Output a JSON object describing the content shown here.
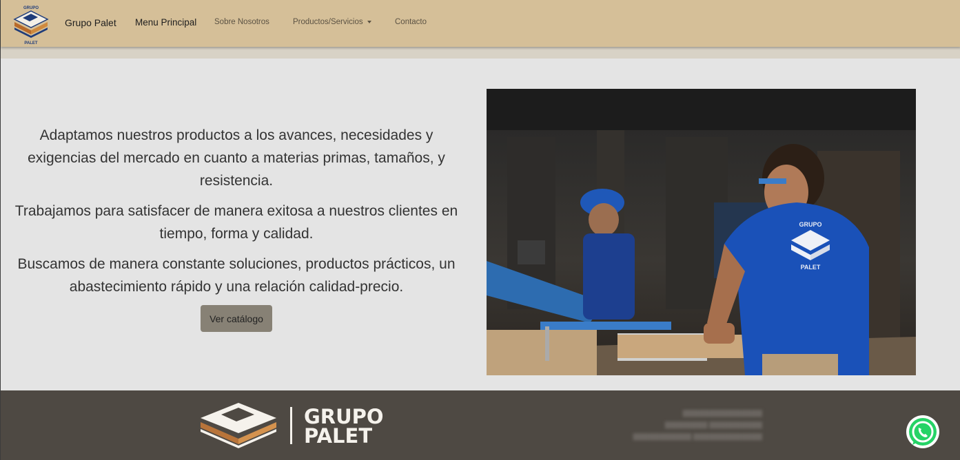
{
  "navbar": {
    "logo_text_top": "GRUPO",
    "logo_text_bottom": "PALET",
    "brand": "Grupo Palet",
    "links": [
      {
        "label": "Menu Principal",
        "active": true
      },
      {
        "label": "Sobre Nosotros",
        "active": false
      },
      {
        "label": "Productos/Servicios",
        "active": false,
        "dropdown": true
      },
      {
        "label": "Contacto",
        "active": false
      }
    ]
  },
  "hero": {
    "paragraphs": [
      "Adaptamos nuestros productos a los avances, necesidades y exigencias del mercado en cuanto a materias primas, tamaños, y resistencia.",
      "Trabajamos para satisfacer de manera exitosa a nuestros clientes en tiempo, forma y calidad.",
      "Buscamos de manera constante soluciones, productos prácticos, un abastecimiento rápido y una relación calidad-precio."
    ],
    "button_label": "Ver catálogo",
    "photo_shirt_top": "GRUPO",
    "photo_shirt_bottom": "PALET"
  },
  "footer": {
    "logo_line1": "GRUPO",
    "logo_line2": "PALET"
  },
  "colors": {
    "navbar_bg": "#d5bf98",
    "button_bg": "#878175",
    "footer_bg": "#4e4943",
    "whatsapp_green": "#25d366"
  },
  "icons": {
    "whatsapp": "whatsapp-icon",
    "dropdown": "caret-down-icon"
  }
}
